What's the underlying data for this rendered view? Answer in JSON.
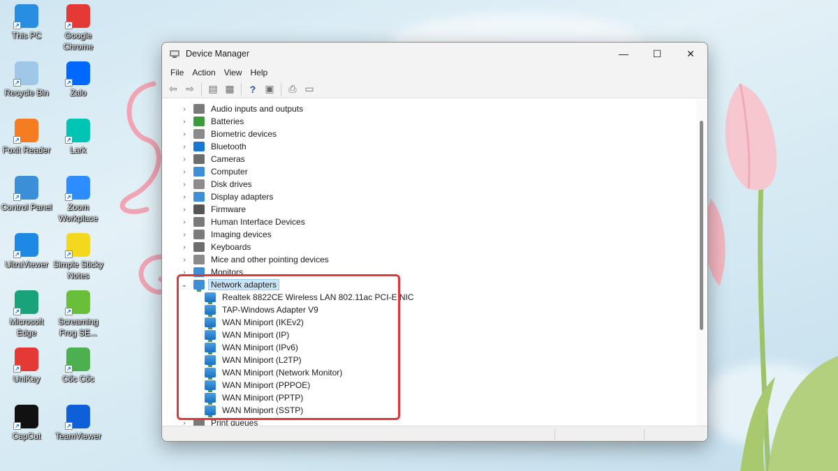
{
  "desktop": {
    "icons": [
      {
        "label": "This PC",
        "icon": "monitor-icon",
        "color": "#2a8ee0"
      },
      {
        "label": "Google Chrome",
        "icon": "chrome-icon",
        "color": "#e53935"
      },
      {
        "label": "Recycle Bin",
        "icon": "recycle-bin-icon",
        "color": "#9fc7e8"
      },
      {
        "label": "Zalo",
        "icon": "zalo-icon",
        "color": "#0068ff"
      },
      {
        "label": "Foxit Reader",
        "icon": "foxit-icon",
        "color": "#f57c20"
      },
      {
        "label": "Lark",
        "icon": "lark-icon",
        "color": "#00c4b4"
      },
      {
        "label": "Control Panel",
        "icon": "control-panel-icon",
        "color": "#3a8fd6"
      },
      {
        "label": "Zoom Workplace",
        "icon": "zoom-icon",
        "color": "#2d8cff"
      },
      {
        "label": "UltraViewer",
        "icon": "ultraviewer-icon",
        "color": "#1e88e5"
      },
      {
        "label": "Simple Sticky Notes",
        "icon": "sticky-notes-icon",
        "color": "#f4d81e"
      },
      {
        "label": "Microsoft Edge",
        "icon": "edge-icon",
        "color": "#1aa37a"
      },
      {
        "label": "Screaming Frog SE...",
        "icon": "screaming-frog-icon",
        "color": "#6abf3a"
      },
      {
        "label": "UniKey",
        "icon": "unikey-icon",
        "color": "#e53935"
      },
      {
        "label": "Cốc Cốc",
        "icon": "coccoc-icon",
        "color": "#4caf50"
      },
      {
        "label": "CapCut",
        "icon": "capcut-icon",
        "color": "#111111"
      },
      {
        "label": "TeamViewer",
        "icon": "teamviewer-icon",
        "color": "#0e5fd8"
      }
    ]
  },
  "window": {
    "title": "Device Manager",
    "controls": {
      "minimize": "—",
      "maximize": "☐",
      "close": "✕"
    },
    "menu": [
      "File",
      "Action",
      "View",
      "Help"
    ],
    "toolbar": [
      {
        "icon": "back-arrow-icon",
        "glyph": "⇦"
      },
      {
        "icon": "forward-arrow-icon",
        "glyph": "⇨"
      },
      {
        "icon": "properties-icon",
        "glyph": "▤"
      },
      {
        "icon": "device-list-icon",
        "glyph": "▦"
      },
      {
        "icon": "help-icon",
        "glyph": "?"
      },
      {
        "icon": "view-resources-icon",
        "glyph": "▣"
      },
      {
        "icon": "update-driver-icon",
        "glyph": "⎙"
      },
      {
        "icon": "monitor-scan-icon",
        "glyph": "▭"
      }
    ]
  },
  "tree": {
    "categories": [
      {
        "label": "Audio inputs and outputs",
        "icon": "speaker-icon",
        "color": "#7a7a7a"
      },
      {
        "label": "Batteries",
        "icon": "battery-icon",
        "color": "#3c9a3c"
      },
      {
        "label": "Biometric devices",
        "icon": "fingerprint-icon",
        "color": "#8a8a8a"
      },
      {
        "label": "Bluetooth",
        "icon": "bluetooth-icon",
        "color": "#1976d2"
      },
      {
        "label": "Cameras",
        "icon": "camera-icon",
        "color": "#6d6d6d"
      },
      {
        "label": "Computer",
        "icon": "computer-icon",
        "color": "#3f8fd8"
      },
      {
        "label": "Disk drives",
        "icon": "disk-icon",
        "color": "#8c8c8c"
      },
      {
        "label": "Display adapters",
        "icon": "display-adapter-icon",
        "color": "#3f8fd8"
      },
      {
        "label": "Firmware",
        "icon": "firmware-icon",
        "color": "#555555"
      },
      {
        "label": "Human Interface Devices",
        "icon": "hid-icon",
        "color": "#7a7a7a"
      },
      {
        "label": "Imaging devices",
        "icon": "imaging-icon",
        "color": "#7a7a7a"
      },
      {
        "label": "Keyboards",
        "icon": "keyboard-icon",
        "color": "#6d6d6d"
      },
      {
        "label": "Mice and other pointing devices",
        "icon": "mouse-icon",
        "color": "#8a8a8a"
      },
      {
        "label": "Monitors",
        "icon": "monitor-icon",
        "color": "#3f8fd8"
      }
    ],
    "expanded": {
      "label": "Network adapters",
      "icon": "network-adapter-icon",
      "children": [
        "Realtek 8822CE Wireless LAN 802.11ac PCI-E NIC",
        "TAP-Windows Adapter V9",
        "WAN Miniport (IKEv2)",
        "WAN Miniport (IP)",
        "WAN Miniport (IPv6)",
        "WAN Miniport (L2TP)",
        "WAN Miniport (Network Monitor)",
        "WAN Miniport (PPPOE)",
        "WAN Miniport (PPTP)",
        "WAN Miniport (SSTP)"
      ]
    },
    "after": [
      {
        "label": "Print queues",
        "icon": "printer-icon",
        "color": "#7a7a7a"
      }
    ]
  },
  "colors": {
    "highlight_border": "#e0363a",
    "selection": "#cce4f7"
  }
}
